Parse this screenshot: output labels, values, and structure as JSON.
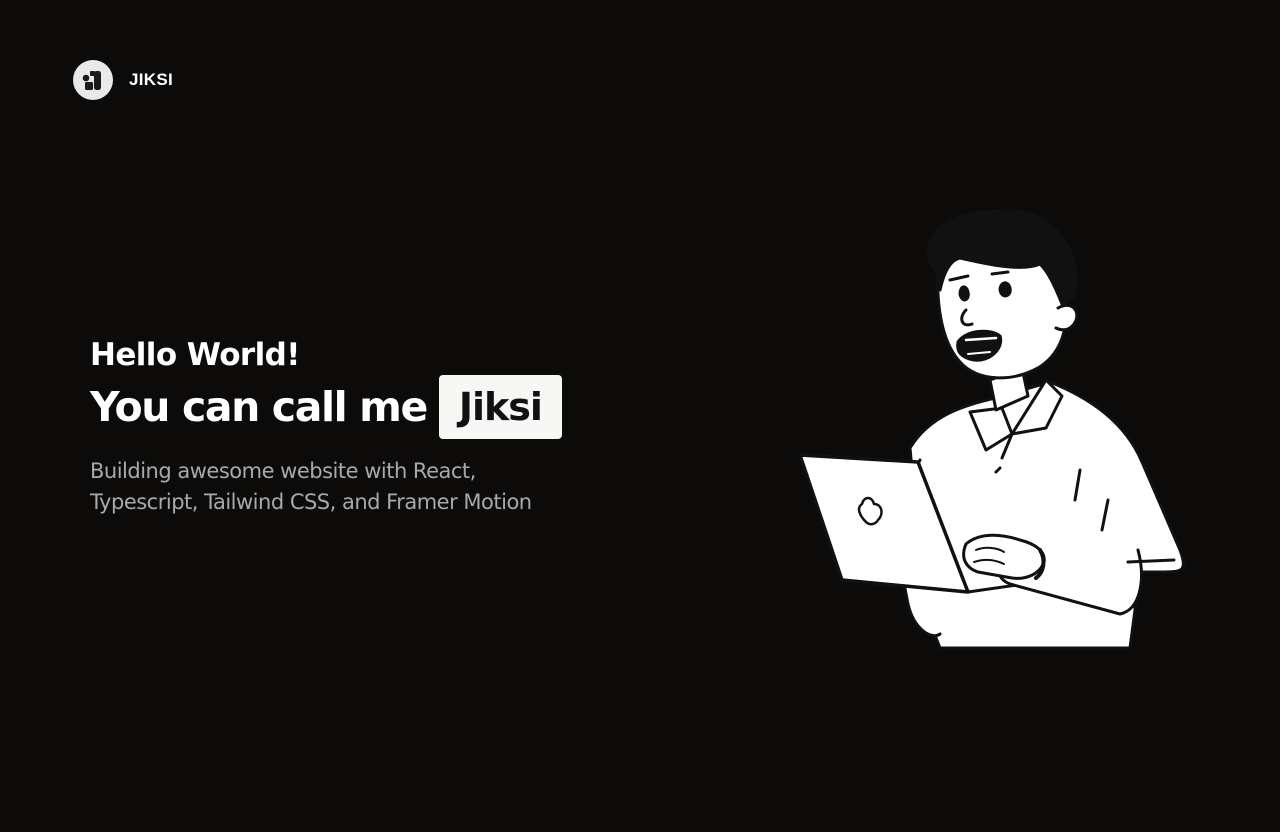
{
  "brand": {
    "name": "JIKSI",
    "logo_icon": "jiksi-logo-icon"
  },
  "hero": {
    "greeting": "Hello World!",
    "headline_prefix": "You can call me",
    "name": "Jiksi",
    "subtitle_line1": "Building awesome website with React,",
    "subtitle_line2": "Typescript, Tailwind CSS, and Framer Motion"
  },
  "illustration": {
    "icon": "person-with-laptop-illustration"
  },
  "colors": {
    "background": "#0c0b0a",
    "text_primary": "#ffffff",
    "text_secondary": "#a9a9a9",
    "highlight_bg": "#f7f7f5",
    "highlight_text": "#111111"
  }
}
